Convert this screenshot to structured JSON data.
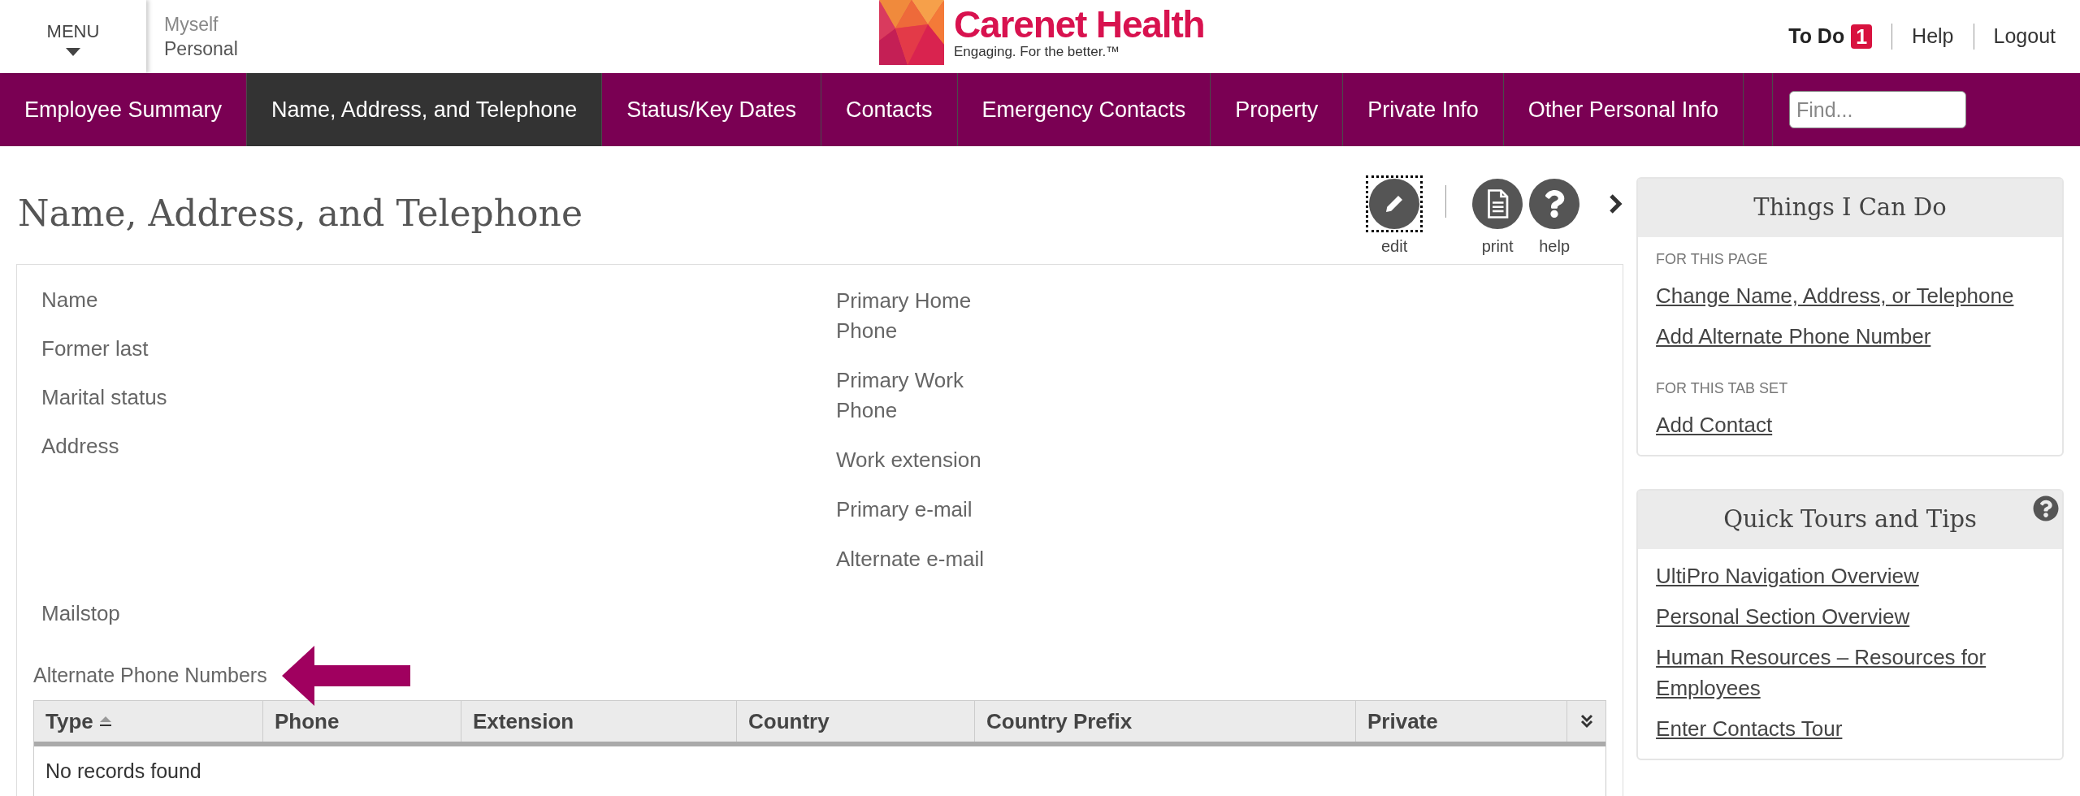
{
  "header": {
    "menu": {
      "label": "MENU"
    },
    "context": {
      "line1": "Myself",
      "line2": "Personal"
    },
    "logo": {
      "name": "Carenet Health",
      "tagline": "Engaging. For the better.™"
    },
    "todo": {
      "label": "To Do",
      "count": "1"
    },
    "links": [
      "Help",
      "Logout"
    ]
  },
  "nav": {
    "tabs": [
      {
        "label": "Employee Summary",
        "selected": false
      },
      {
        "label": "Name, Address, and Telephone",
        "selected": true
      },
      {
        "label": "Status/Key Dates",
        "selected": false
      },
      {
        "label": "Contacts",
        "selected": false
      },
      {
        "label": "Emergency Contacts",
        "selected": false
      },
      {
        "label": "Property",
        "selected": false
      },
      {
        "label": "Private Info",
        "selected": false
      },
      {
        "label": "Other Personal Info",
        "selected": false
      }
    ],
    "search": {
      "placeholder": "Find..."
    }
  },
  "page": {
    "title": "Name, Address, and Telephone",
    "toolbar": [
      {
        "kind": "edit",
        "label": "edit",
        "focused": true
      },
      {
        "kind": "print",
        "label": "print",
        "focused": false
      },
      {
        "kind": "help",
        "label": "help",
        "focused": false
      }
    ],
    "fields_left": [
      {
        "label": "Name",
        "kind": "line"
      },
      {
        "label": "Former last",
        "kind": "line"
      },
      {
        "label": "Marital status",
        "kind": "line"
      },
      {
        "label": "Address",
        "kind": "block"
      },
      {
        "label": "Mailstop",
        "kind": "line"
      }
    ],
    "fields_right": [
      {
        "label": "Primary Home Phone"
      },
      {
        "label": "Primary Work Phone"
      },
      {
        "label": "Work extension"
      },
      {
        "label": "Primary e-mail"
      },
      {
        "label": "Alternate e-mail"
      }
    ],
    "alternate_phones": {
      "title": "Alternate Phone Numbers",
      "columns": [
        {
          "label": "Type",
          "sorted": true
        },
        {
          "label": "Phone",
          "sorted": false
        },
        {
          "label": "Extension",
          "sorted": false
        },
        {
          "label": "Country",
          "sorted": false
        },
        {
          "label": "Country Prefix",
          "sorted": false
        },
        {
          "label": "Private",
          "sorted": false
        }
      ],
      "empty_message": "No records found"
    }
  },
  "sidebar": [
    {
      "title": "Things I Can Do",
      "help": false,
      "sections": [
        {
          "heading": "FOR THIS PAGE",
          "links": [
            "Change Name, Address, or Telephone",
            "Add Alternate Phone Number"
          ]
        },
        {
          "heading": "FOR THIS TAB SET",
          "links": [
            "Add Contact"
          ]
        }
      ]
    },
    {
      "title": "Quick Tours and Tips",
      "help": true,
      "sections": [
        {
          "links": [
            "UltiPro Navigation Overview",
            "Personal Section Overview",
            "Human Resources – Resources for Employees",
            "Enter Contacts Tour"
          ]
        }
      ]
    }
  ]
}
